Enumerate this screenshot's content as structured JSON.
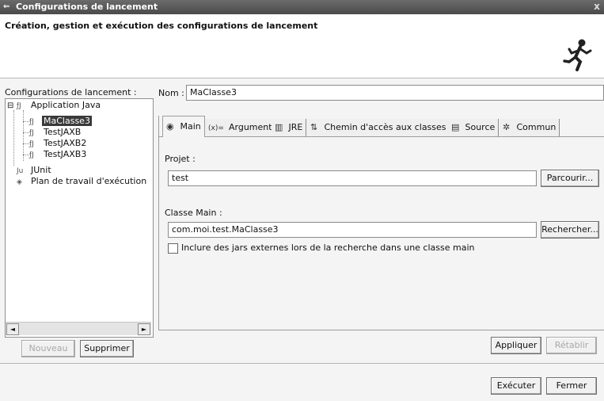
{
  "window": {
    "title": "Configurations de lancement",
    "close_glyph": "x"
  },
  "header": {
    "title": "Création, gestion et exécution des configurations de lancement"
  },
  "left": {
    "label": "Configurations de lancement :",
    "tree": [
      {
        "label": "Application Java",
        "icon": "java-app-icon",
        "expander": "⊟",
        "glyph": "ƒJ"
      },
      {
        "label": "MaClasse3",
        "icon": "java-class-icon",
        "selected": true,
        "glyph": "ƒJ"
      },
      {
        "label": "TestJAXB",
        "icon": "java-class-icon",
        "glyph": "ƒJ"
      },
      {
        "label": "TestJAXB2",
        "icon": "java-class-icon",
        "glyph": "ƒJ"
      },
      {
        "label": "TestJAXB3",
        "icon": "java-class-icon",
        "glyph": "ƒJ"
      },
      {
        "label": "JUnit",
        "icon": "junit-icon",
        "glyph": "Ju"
      },
      {
        "label": "Plan de travail d'exécution",
        "icon": "workbench-icon",
        "glyph": "◈"
      }
    ],
    "scroll_left": "◄",
    "scroll_right": "►",
    "new_button": "Nouveau",
    "delete_button": "Supprimer"
  },
  "form": {
    "name_label": "Nom :",
    "name_value": "MaClasse3",
    "tabs": [
      {
        "label": "Main",
        "icon": "main-icon",
        "glyph": "◉"
      },
      {
        "label": "Arguments",
        "icon": "arguments-icon",
        "glyph": "(x)="
      },
      {
        "label": "JRE",
        "icon": "jre-icon",
        "glyph": "▥"
      },
      {
        "label": "Chemin d'accès aux classes",
        "icon": "classpath-icon",
        "glyph": "⇅"
      },
      {
        "label": "Source",
        "icon": "source-icon",
        "glyph": "▤"
      },
      {
        "label": "Commun",
        "icon": "common-icon",
        "glyph": "✲"
      }
    ],
    "project_label": "Projet :",
    "project_value": "test",
    "browse_button": "Parcourir...",
    "main_class_label": "Classe Main :",
    "main_class_value": "com.moi.test.MaClasse3",
    "search_button": "Rechercher...",
    "include_external_label": "Inclure des jars externes lors de la recherche dans une classe main",
    "include_external_checked": false,
    "apply_button": "Appliquer",
    "revert_button": "Rétablir"
  },
  "footer": {
    "run_button": "Exécuter",
    "close_button": "Fermer"
  }
}
